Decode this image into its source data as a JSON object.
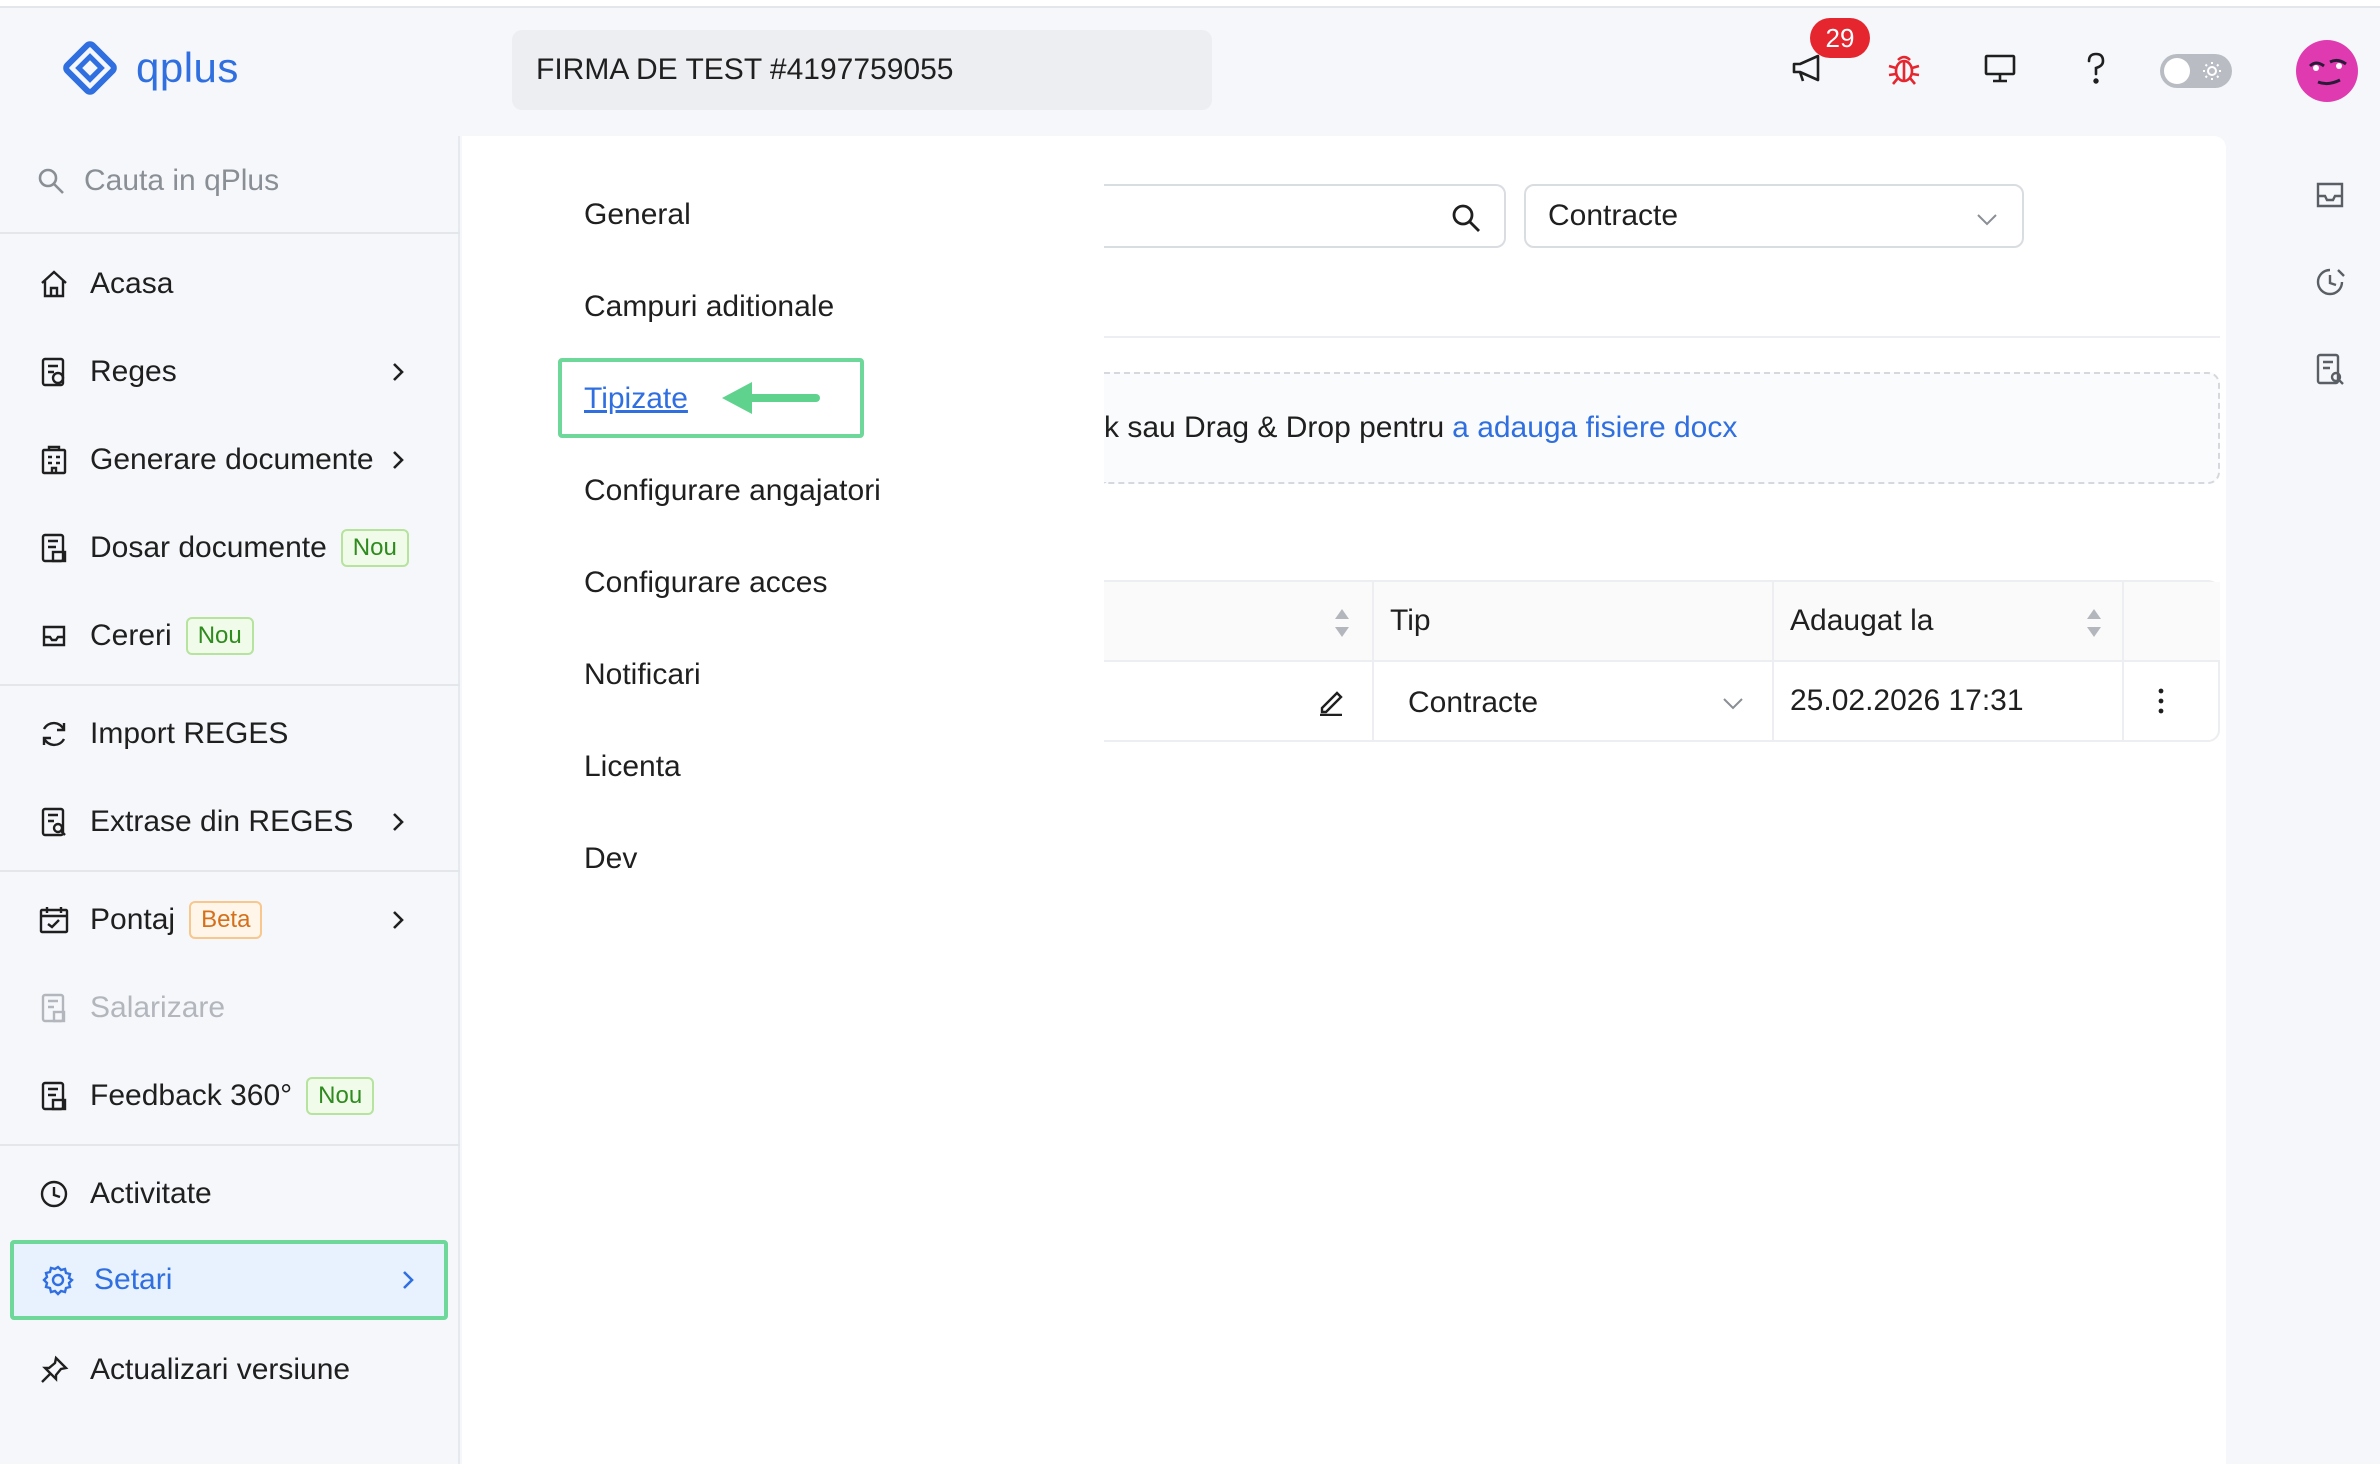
{
  "header": {
    "logo_text": "qplus",
    "company_name": "FIRMA DE TEST #4197759055",
    "notifications_count": "29",
    "accent_color": "#2f6fe0"
  },
  "sidebar": {
    "search_placeholder": "Cauta in qPlus",
    "items": [
      {
        "label": "Acasa",
        "icon": "home-icon"
      },
      {
        "label": "Reges",
        "icon": "document-icon",
        "has_submenu": true
      },
      {
        "label": "Generare documente",
        "icon": "building-doc-icon",
        "has_submenu": true
      },
      {
        "label": "Dosar documente",
        "icon": "folder-doc-icon",
        "tag": "Nou"
      },
      {
        "label": "Cereri",
        "icon": "inbox-icon",
        "tag": "Nou"
      },
      {
        "label": "Import REGES",
        "icon": "sync-icon"
      },
      {
        "label": "Extrase din REGES",
        "icon": "document-search-icon",
        "has_submenu": true
      },
      {
        "label": "Pontaj",
        "icon": "calendar-icon",
        "tag": "Beta",
        "has_submenu": true
      },
      {
        "label": "Salarizare",
        "icon": "payroll-icon",
        "disabled": true
      },
      {
        "label": "Feedback 360°",
        "icon": "feedback-icon",
        "tag": "Nou"
      },
      {
        "label": "Activitate",
        "icon": "clock-icon"
      },
      {
        "label": "Setari",
        "icon": "gear-icon",
        "has_submenu": true,
        "active": true
      },
      {
        "label": "Actualizari versiune",
        "icon": "pin-icon"
      }
    ]
  },
  "submenu": {
    "items": [
      "General",
      "Campuri aditionale",
      "Tipizate",
      "Configurare angajatori",
      "Configurare acces",
      "Notificari",
      "Licenta",
      "Dev"
    ],
    "active": "Tipizate"
  },
  "main": {
    "filter_select_value": "Contracte",
    "dropzone_text": "k sau Drag & Drop pentru",
    "dropzone_link": "a adauga fisiere docx",
    "table": {
      "headers": [
        "",
        "Tip",
        "Adaugat la",
        ""
      ],
      "rows": [
        {
          "tip": "Contracte",
          "adaugat_la": "25.02.2026 17:31"
        }
      ]
    }
  }
}
